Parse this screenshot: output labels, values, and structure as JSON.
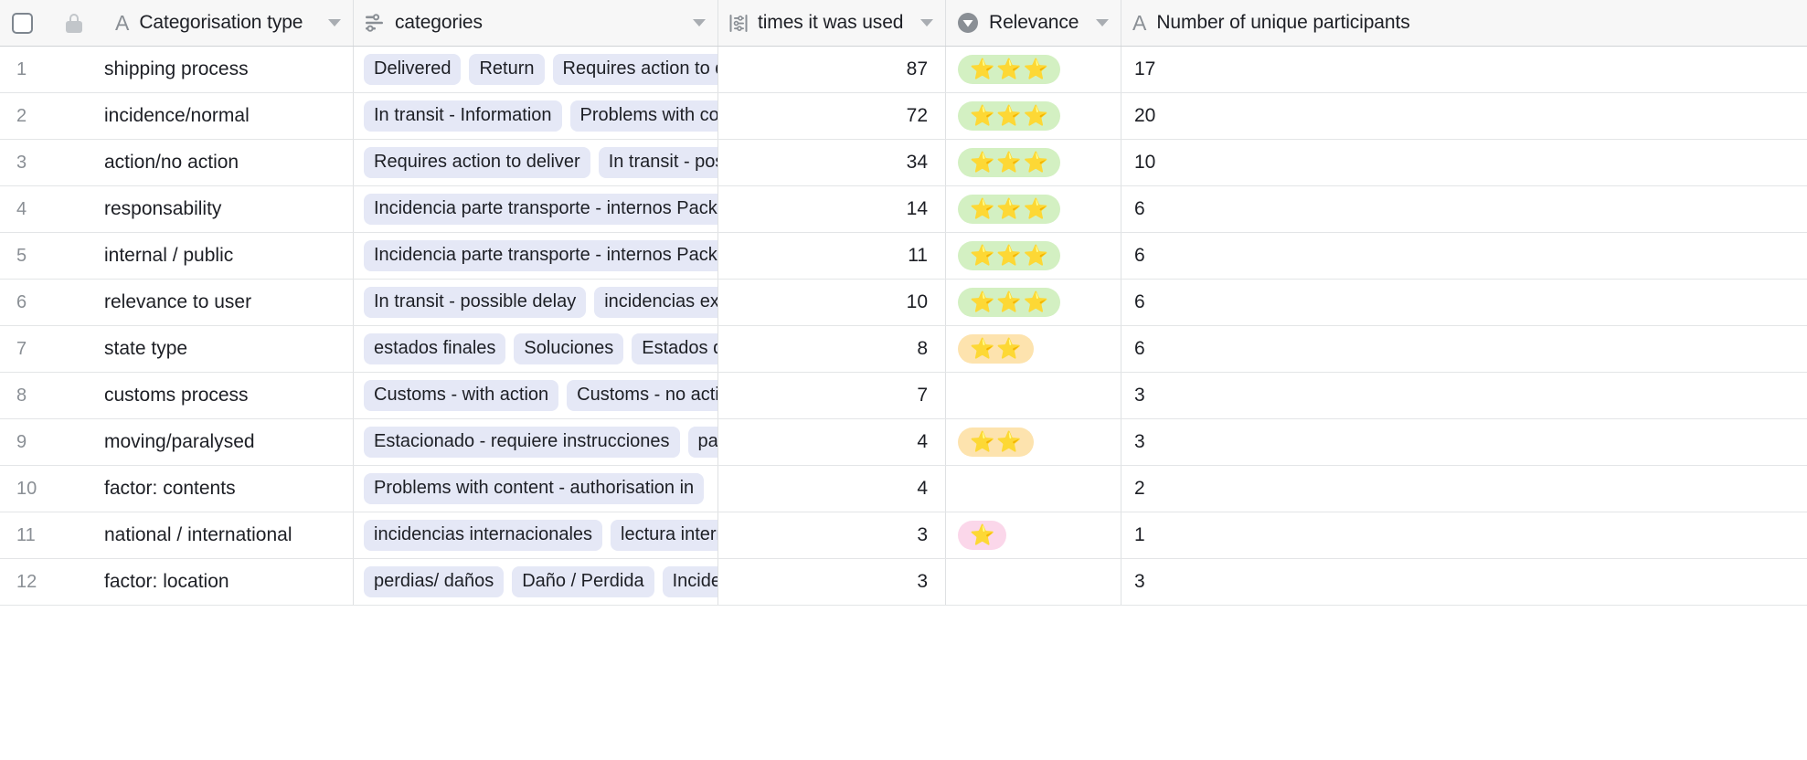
{
  "toolbar": {
    "select_all_checkbox": "",
    "lock_icon_label": "locked field"
  },
  "columns": [
    {
      "key": "row_number",
      "label": "",
      "icon": "checkbox-icon",
      "type": "rownum"
    },
    {
      "key": "lock",
      "label": "",
      "icon": "lock-icon",
      "type": "lock"
    },
    {
      "key": "categorisation_type",
      "label": "Categorisation type",
      "icon": "text-A-icon",
      "type": "text",
      "has_caret": true
    },
    {
      "key": "categories",
      "label": "categories",
      "icon": "multi-select-icon",
      "type": "tags",
      "has_caret": true
    },
    {
      "key": "times_it_was_used",
      "label": "times it was used",
      "icon": "count-icon",
      "type": "number",
      "has_caret": true
    },
    {
      "key": "relevance",
      "label": "Relevance",
      "icon": "single-select-icon",
      "type": "rating",
      "has_caret": true
    },
    {
      "key": "number_of_unique_participants",
      "label": "Number of unique participants",
      "icon": "text-A-icon",
      "type": "text",
      "has_caret": false
    }
  ],
  "colors": {
    "tag_background": "#e5e8f6",
    "rating_green": "#d3f0c2",
    "rating_orange": "#fde3ae",
    "rating_pink": "#fbd7ea",
    "header_background": "#f7f7f7",
    "grid_line": "#dfe1e3",
    "row_number_text": "#8a8f95"
  },
  "rows": [
    {
      "n": "1",
      "categorisation_type": "shipping process",
      "categories": [
        "Delivered",
        "Return",
        "Requires action to deliver"
      ],
      "times_it_was_used": "87",
      "relevance": {
        "stars": 3,
        "color": "green"
      },
      "participants": "17"
    },
    {
      "n": "2",
      "categorisation_type": "incidence/normal",
      "categories": [
        "In transit - Information",
        "Problems with content"
      ],
      "times_it_was_used": "72",
      "relevance": {
        "stars": 3,
        "color": "green"
      },
      "participants": "20"
    },
    {
      "n": "3",
      "categorisation_type": "action/no action",
      "categories": [
        "Requires action to deliver",
        "In transit - possible delay"
      ],
      "times_it_was_used": "34",
      "relevance": {
        "stars": 3,
        "color": "green"
      },
      "participants": "10"
    },
    {
      "n": "4",
      "categorisation_type": "responsability",
      "categories": [
        "Incidencia parte transporte - internos Packlink"
      ],
      "times_it_was_used": "14",
      "relevance": {
        "stars": 3,
        "color": "green"
      },
      "participants": "6"
    },
    {
      "n": "5",
      "categorisation_type": "internal / public",
      "categories": [
        "Incidencia parte transporte - internos Packlink"
      ],
      "times_it_was_used": "11",
      "relevance": {
        "stars": 3,
        "color": "green"
      },
      "participants": "6"
    },
    {
      "n": "6",
      "categorisation_type": "relevance to user",
      "categories": [
        "In transit - possible delay",
        "incidencias externas"
      ],
      "times_it_was_used": "10",
      "relevance": {
        "stars": 3,
        "color": "green"
      },
      "participants": "6"
    },
    {
      "n": "7",
      "categorisation_type": "state type",
      "categories": [
        "estados finales",
        "Soluciones",
        "Estados de transito"
      ],
      "times_it_was_used": "8",
      "relevance": {
        "stars": 2,
        "color": "orange"
      },
      "participants": "6"
    },
    {
      "n": "8",
      "categorisation_type": "customs process",
      "categories": [
        "Customs - with action",
        "Customs - no action"
      ],
      "times_it_was_used": "7",
      "relevance": {
        "stars": 0,
        "color": "none"
      },
      "participants": "3"
    },
    {
      "n": "9",
      "categorisation_type": "moving/paralysed",
      "categories": [
        "Estacionado - requiere instrucciones",
        "parado"
      ],
      "times_it_was_used": "4",
      "relevance": {
        "stars": 2,
        "color": "orange"
      },
      "participants": "3"
    },
    {
      "n": "10",
      "categorisation_type": "factor: contents",
      "categories": [
        "Problems with content - authorisation in"
      ],
      "times_it_was_used": "4",
      "relevance": {
        "stars": 0,
        "color": "none"
      },
      "participants": "2"
    },
    {
      "n": "11",
      "categorisation_type": "national / international",
      "categories": [
        "incidencias internacionales",
        "lectura interna"
      ],
      "times_it_was_used": "3",
      "relevance": {
        "stars": 1,
        "color": "pink"
      },
      "participants": "1"
    },
    {
      "n": "12",
      "categorisation_type": "factor: location",
      "categories": [
        "perdias/ daños",
        "Daño / Perdida",
        "Incidencia"
      ],
      "times_it_was_used": "3",
      "relevance": {
        "stars": 0,
        "color": "none"
      },
      "participants": "3"
    }
  ]
}
